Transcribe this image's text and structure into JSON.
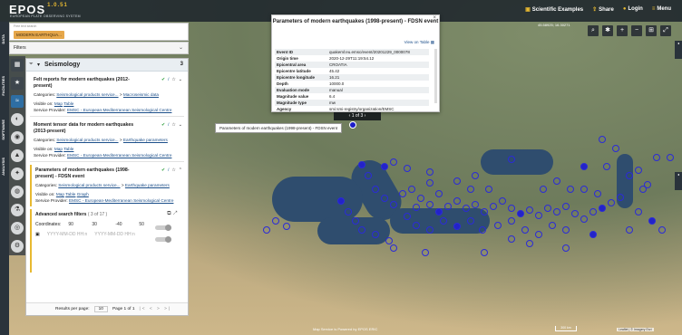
{
  "app": {
    "logo": "EPOS",
    "version": "1.0.51",
    "subtitle": "EUROPEAN PLATE OBSERVING SYSTEM"
  },
  "topbar": {
    "actions": [
      {
        "label": "Scientific Examples",
        "icon": "book-icon"
      },
      {
        "label": "Share",
        "icon": "share-icon"
      },
      {
        "label": "Login",
        "icon": "user-icon"
      },
      {
        "label": "Menu",
        "icon": "menu-icon"
      }
    ]
  },
  "rail": {
    "labels": [
      "DATA",
      "FACILITIES",
      "SOFTWARE",
      "ANALYSIS"
    ]
  },
  "search": {
    "label": "Free text search",
    "chip": "MODERN EARTHQUA..."
  },
  "filters": {
    "label": "Filters"
  },
  "panel": {
    "title": "Seismology",
    "count": "3",
    "items": [
      {
        "title": "Felt reports for modern earthquakes (2012-present)",
        "categories_label": "Categories:",
        "categories_value": "Seismological products service...",
        "categories_sep": " > ",
        "categories_value2": "Macroseismic data",
        "visible_label": "Visible on:",
        "visible": [
          "Map",
          "Table"
        ],
        "provider_label": "Service Provider:",
        "provider": "EMSC - European-Mediterranean Seismological Centre"
      },
      {
        "title": "Moment tensor data for modern earthquakes (2013-present)",
        "categories_label": "Categories:",
        "categories_value": "Seismological products service...",
        "categories_sep": " > ",
        "categories_value2": "Earthquake parameters",
        "visible_label": "Visible on:",
        "visible": [
          "Map",
          "Table"
        ],
        "provider_label": "Service Provider:",
        "provider": "EMSC - European-Mediterranean Seismological Centre"
      },
      {
        "title": "Parameters of modern earthquakes (1998-present) - FDSN event",
        "categories_label": "Categories:",
        "categories_value": "Seismological products service...",
        "categories_sep": " > ",
        "categories_value2": "Earthquake parameters",
        "visible_label": "Visible on:",
        "visible": [
          "Map",
          "Table",
          "Graph"
        ],
        "provider_label": "Service Provider:",
        "provider": "EMSC - European-Mediterranean Seismological Centre"
      }
    ],
    "advanced": {
      "title": "Advanced search filters",
      "count": "( 3 of 17 )",
      "coords_label": "Coordinates:",
      "coords": [
        "90",
        "30",
        "-40",
        "50"
      ],
      "date_from": "YYYY-MM-DD HH:n",
      "date_to": "YYYY-MM-DD HH:n"
    },
    "pager": {
      "results_label": "Results per page:",
      "per_page": "10",
      "page_label": "Page 1 of 1",
      "nav": "|< < > >|"
    }
  },
  "popup": {
    "title": "Parameters of modern earthquakes (1998-present) - FDSN event",
    "view_on_table": "View on Table",
    "close": "×",
    "rows": [
      {
        "k": "Event ID",
        "v": "quakeml:eu.emsc/event/20201229_0000078"
      },
      {
        "k": "Origin time",
        "v": "2020-12-29T11:19:54.12"
      },
      {
        "k": "Epicentral area",
        "v": "CROATIA"
      },
      {
        "k": "Epicentre latitude",
        "v": "45.42"
      },
      {
        "k": "Epicentre longitude",
        "v": "16.21"
      },
      {
        "k": "Depth",
        "v": "10000.0"
      },
      {
        "k": "Evaluation mode",
        "v": "manual"
      },
      {
        "k": "Magnitude value",
        "v": "6.4"
      },
      {
        "k": "Magnitude type",
        "v": "mw"
      },
      {
        "k": "Agency",
        "v": "smi:smi-registry/organization/EMSC"
      }
    ],
    "nav_text": "1 of 3"
  },
  "tooltip": "Parameters of modern earthquakes (1998-present) - FDSN event",
  "map": {
    "coords": "45.58925; 16.30271",
    "credit": "Map Service is Powered by EPOS ERIC",
    "scale": "300 km",
    "attrib": "Leaflet | © Imagery Esri",
    "marker_color": "#2b2bd8"
  }
}
